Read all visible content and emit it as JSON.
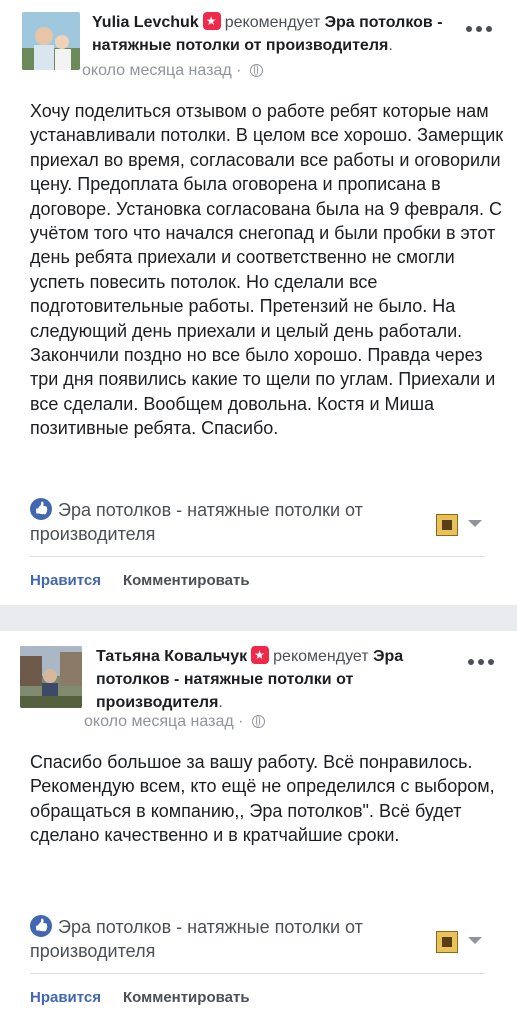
{
  "post1": {
    "author": "Yulia Levchuk",
    "verb": "рекомендует",
    "page": "Эра потолков - натяжные потолки от производителя",
    "page_trail": ".",
    "time": "около месяца назад",
    "time_sep": "·",
    "text": "Хочу поделиться отзывом о работе ребят которые нам устанавливали потолки. В целом все хорошо. Замерщик приехал во время, согласовали все работы и оговорили цену. Предоплата была оговорена и прописана в договоре. Установка согласована была на 9 февраля. С учётом того что начался снегопад и были пробки в этот день ребята приехали и соответственно не смогли успеть повесить потолок. Но сделали все подготовительные работы. Претензий не было. На следующий день приехали и целый день работали. Закончили поздно но все было хорошо. Правда через три дня появились какие то щели по углам. Приехали и все сделали. Вообщем довольна. Костя и Миша позитивные ребята. Спасибо.",
    "page_box": "Эра потолков - натяжные потолки от производителя",
    "like": "Нравится",
    "comment": "Комментировать"
  },
  "post2": {
    "author": "Татьяна Ковальчук",
    "verb": "рекомендует",
    "page": "Эра потолков - натяжные потолки от производителя",
    "page_trail": ".",
    "time": "около месяца назад",
    "time_sep": "·",
    "text": "Спасибо большое за вашу работу. Всё понравилось. Рекомендую всем, кто ещё не определился с выбором, обращаться в компанию,, Эра потолков\". Всё будет сделано качественно и в кратчайшие сроки.",
    "page_box": "Эра потолков - натяжные потолки от производителя",
    "like": "Нравится",
    "comment": "Комментировать"
  },
  "icons": {
    "recommend": "recommend-star-icon",
    "privacy": "globe-icon",
    "more": "more-options-icon",
    "like_badge": "thumbs-up-icon",
    "dropdown": "chevron-down-icon"
  },
  "colors": {
    "link": "#4267b2",
    "recommend_badge": "#f0284a",
    "meta": "#90949c",
    "separator": "#e9ebee"
  }
}
